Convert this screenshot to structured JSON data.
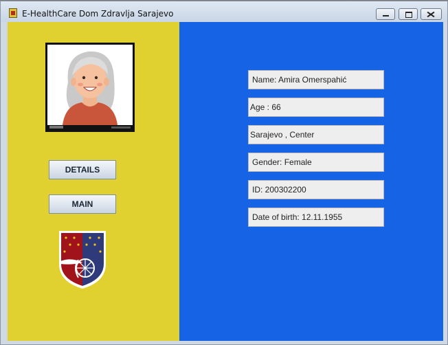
{
  "window": {
    "title": "E-HealthCare Dom Zdravlja Sarajevo"
  },
  "sidebar": {
    "details_label": "DETAILS",
    "main_label": "MAIN"
  },
  "profile": {
    "photo_icon": "elderly-woman-avatar",
    "crest_icon": "sarajevo-coat-of-arms",
    "fields": [
      "Name: Amira Omerspahić",
      "Age : 66",
      "Sarajevo , Center",
      "Gender: Female",
      "ID: 200302200",
      "Date of birth: 12.11.1955"
    ]
  },
  "colors": {
    "left_panel": "#e0d030",
    "right_panel": "#1763e6",
    "field_bg": "#eeeeee"
  }
}
